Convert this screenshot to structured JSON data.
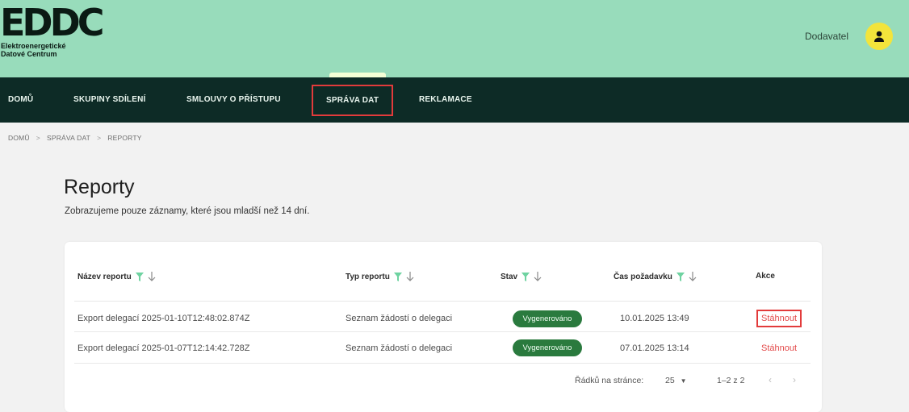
{
  "header": {
    "logo_mark": "EDDC",
    "logo_line1": "Elektroenergetické",
    "logo_line2": "Datové Centrum",
    "user_label": "Dodavatel"
  },
  "nav": {
    "items": [
      {
        "label": "DOMŮ"
      },
      {
        "label": "SKUPINY SDÍLENÍ"
      },
      {
        "label": "SMLOUVY O PŘÍSTUPU"
      },
      {
        "label": "SPRÁVA DAT"
      },
      {
        "label": "REKLAMACE"
      }
    ]
  },
  "breadcrumb": {
    "items": [
      "DOMŮ",
      "SPRÁVA DAT",
      "REPORTY"
    ],
    "separator": ">"
  },
  "page": {
    "title": "Reporty",
    "subtitle": "Zobrazujeme pouze záznamy, které jsou mladší než 14 dní."
  },
  "table": {
    "columns": [
      "Název reportu",
      "Typ reportu",
      "Stav",
      "Čas požadavku",
      "Akce"
    ],
    "rows": [
      {
        "name": "Export delegací 2025-01-10T12:48:02.874Z",
        "type": "Seznam žádostí o delegaci",
        "status": "Vygenerováno",
        "time": "10.01.2025 13:49",
        "action": "Stáhnout"
      },
      {
        "name": "Export delegací 2025-01-07T12:14:42.728Z",
        "type": "Seznam žádostí o delegaci",
        "status": "Vygenerováno",
        "time": "07.01.2025 13:14",
        "action": "Stáhnout"
      }
    ]
  },
  "pagination": {
    "rows_per_page_label": "Řádků na stránce:",
    "rows_per_page_value": "25",
    "range": "1–2 z 2",
    "prev_icon": "chevron-left-icon",
    "next_icon": "chevron-right-icon"
  },
  "colors": {
    "header_bg": "#98dcbb",
    "nav_bg": "#0d2b26",
    "accent_filter": "#6fd3a1",
    "badge_bg": "#2a7a3e",
    "action_red": "#e34a4a",
    "highlight_box": "#e23b3b",
    "avatar_bg": "#f3e43b"
  }
}
